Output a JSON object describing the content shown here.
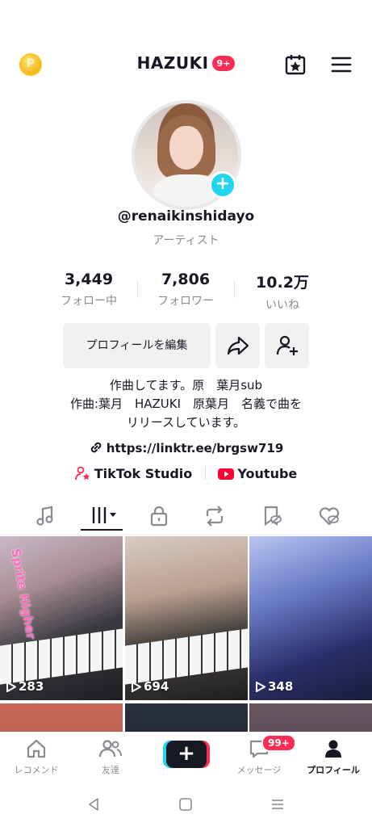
{
  "header": {
    "title": "HAZUKI",
    "notification_badge": "9+"
  },
  "profile": {
    "username": "@renaikinshidayo",
    "role": "アーティスト",
    "stats": [
      {
        "value": "3,449",
        "label": "フォロー中"
      },
      {
        "value": "7,806",
        "label": "フォロワー"
      },
      {
        "value": "10.2万",
        "label": "いいね"
      }
    ],
    "edit_button": "プロフィールを編集",
    "bio": [
      "作曲してます。原　葉月sub",
      "作曲:葉月　HAZUKI　原葉月　名義で曲を",
      "リリースしています。"
    ],
    "link": "https://linktr.ee/brgsw719",
    "external": [
      {
        "label": "TikTok Studio"
      },
      {
        "label": "Youtube"
      }
    ]
  },
  "videos": [
    {
      "views": "283",
      "overlay": "Sprite Higher"
    },
    {
      "views": "694",
      "overlay": ""
    },
    {
      "views": "348",
      "overlay": ""
    }
  ],
  "nav": {
    "items": [
      {
        "label": "レコメンド",
        "icon": "home-icon"
      },
      {
        "label": "友達",
        "icon": "friends-icon"
      },
      {
        "label": "メッセージ",
        "icon": "inbox-icon",
        "badge": "99+"
      },
      {
        "label": "プロフィール",
        "icon": "profile-icon"
      }
    ]
  },
  "colors": {
    "accent": "#fe2c55",
    "cyan": "#20d5ec",
    "text": "#161823",
    "muted": "#8a8b91"
  }
}
